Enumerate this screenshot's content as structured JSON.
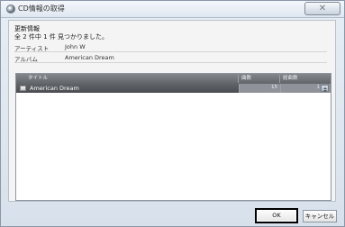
{
  "window": {
    "title": "CD情報の取得",
    "close_label": "✕"
  },
  "info": {
    "heading": "更新情報",
    "subtext": "全 2 件中 1 件 見つかりました。",
    "artist_label": "アーティスト",
    "artist_value": "John W",
    "album_label": "アルバム",
    "album_value": "American Dream"
  },
  "table": {
    "headers": {
      "title": "タイトル",
      "track": "曲数",
      "total": "総曲数"
    },
    "row": {
      "title": "American Dream",
      "track": "15",
      "total": "1"
    }
  },
  "buttons": {
    "ok": "OK",
    "cancel": "キャンセル"
  }
}
